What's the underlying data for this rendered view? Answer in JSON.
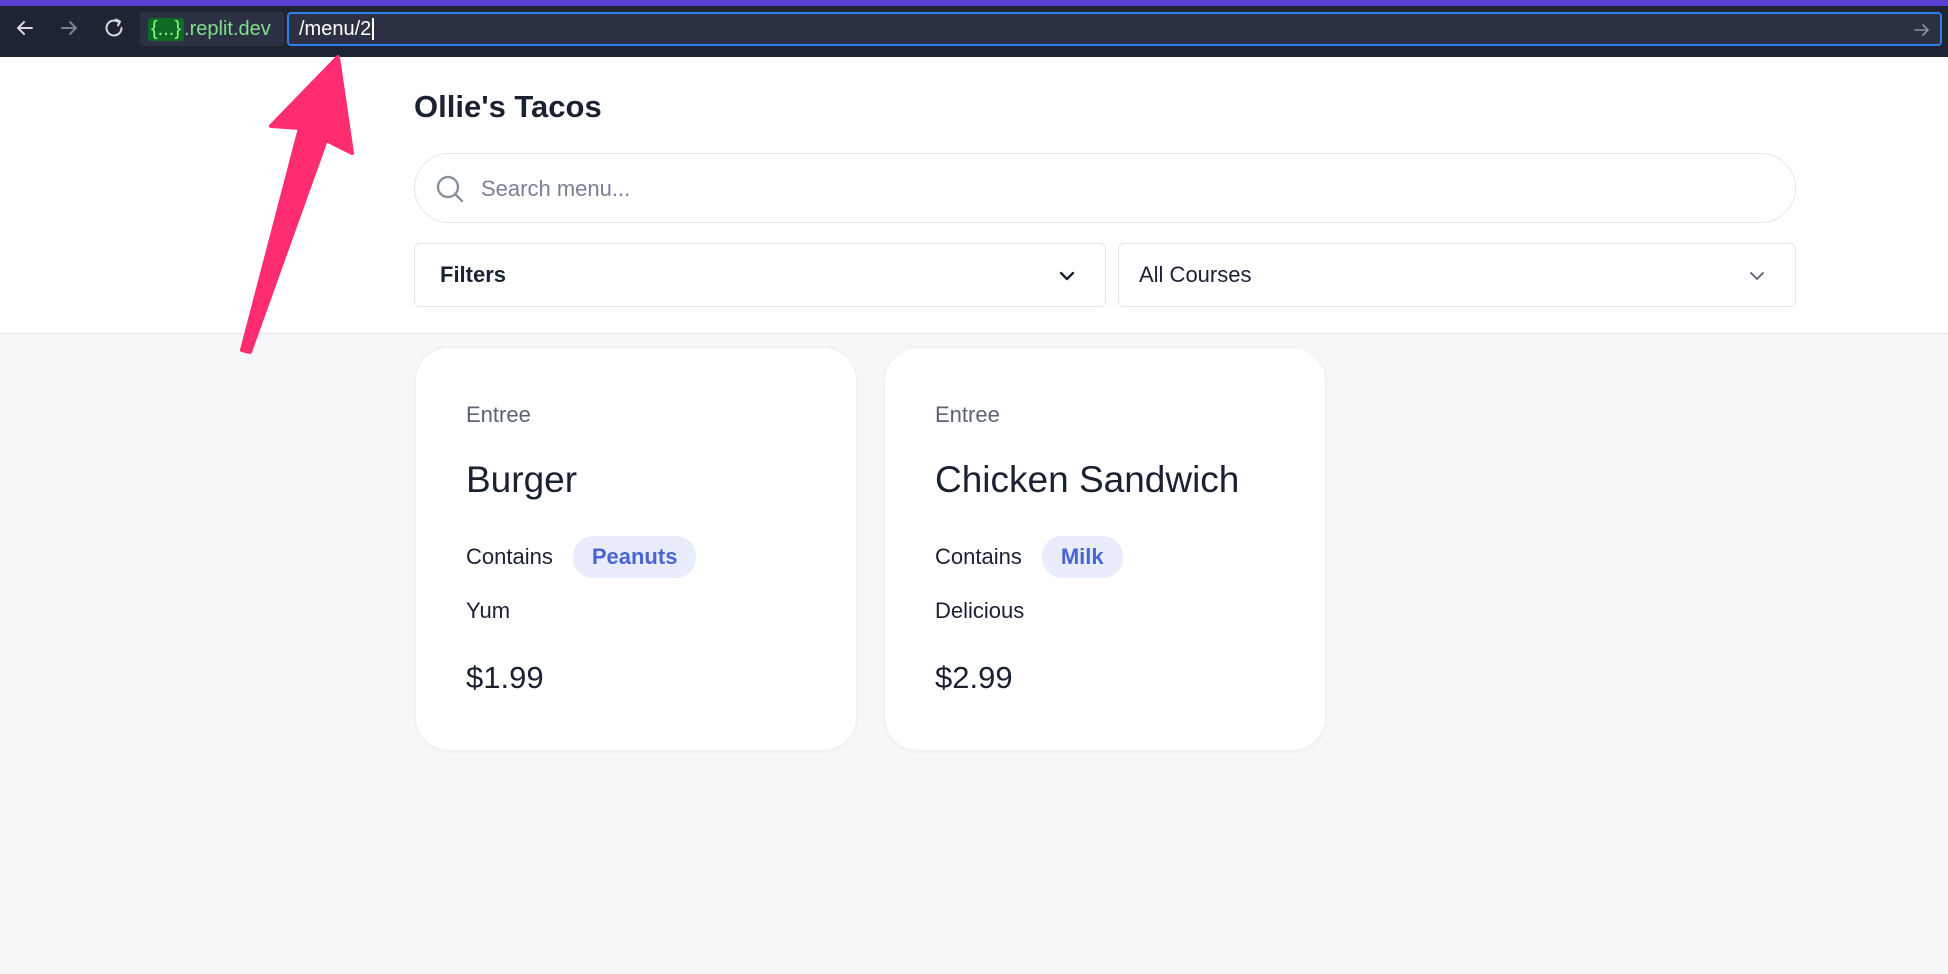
{
  "browser": {
    "host_chip": "{...}",
    "host_suffix": ".replit.dev",
    "url_value": "/menu/2"
  },
  "page": {
    "title": "Ollie's Tacos"
  },
  "search": {
    "placeholder": "Search menu..."
  },
  "filters": {
    "filters_label": "Filters",
    "course_label": "All Courses"
  },
  "menu_items": [
    {
      "course": "Entree",
      "name": "Burger",
      "contains_label": "Contains",
      "allergen": "Peanuts",
      "description": "Yum",
      "price": "$1.99"
    },
    {
      "course": "Entree",
      "name": "Chicken Sandwich",
      "contains_label": "Contains",
      "allergen": "Milk",
      "description": "Delicious",
      "price": "$2.99"
    }
  ],
  "colors": {
    "accent_bar": "#5b3fd6",
    "url_focus": "#2f80ed",
    "badge_text": "#4a63d6",
    "badge_bg": "#e9edfb",
    "annotation_arrow": "#ff2d6f"
  },
  "icons": [
    "back-arrow-icon",
    "forward-arrow-icon",
    "reload-icon",
    "go-arrow-icon",
    "search-icon",
    "chevron-down-icon"
  ]
}
